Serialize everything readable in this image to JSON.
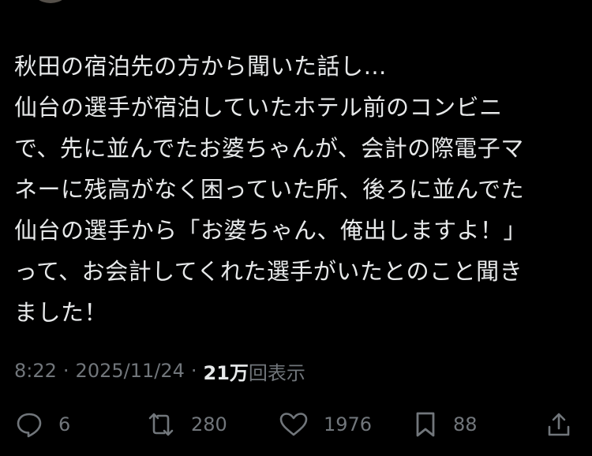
{
  "tweet": {
    "lines": [
      "秋田の宿泊先の方から聞いた話し…",
      "仙台の選手が宿泊していたホテル前のコンビニ",
      "で、先に並んでたお婆ちゃんが、会計の際電子マ",
      "ネーに残高がなく困っていた所、後ろに並んでた",
      "仙台の選手から「お婆ちゃん、俺出しますよ！」",
      "って、お会計してくれた選手がいたとのこと聞き",
      "ました！"
    ],
    "time": "8:22",
    "separator": "·",
    "date": "2025/11/24",
    "views_count": "21万",
    "views_label": "回表示"
  },
  "actions": {
    "replies": "6",
    "reposts": "280",
    "likes": "1976",
    "bookmarks": "88"
  },
  "icons": {
    "reply": "reply-icon",
    "repost": "repost-icon",
    "like": "heart-icon",
    "bookmark": "bookmark-icon",
    "share": "share-icon"
  },
  "colors": {
    "background": "#000000",
    "text": "#e7e9ea",
    "secondary": "#71767b"
  }
}
